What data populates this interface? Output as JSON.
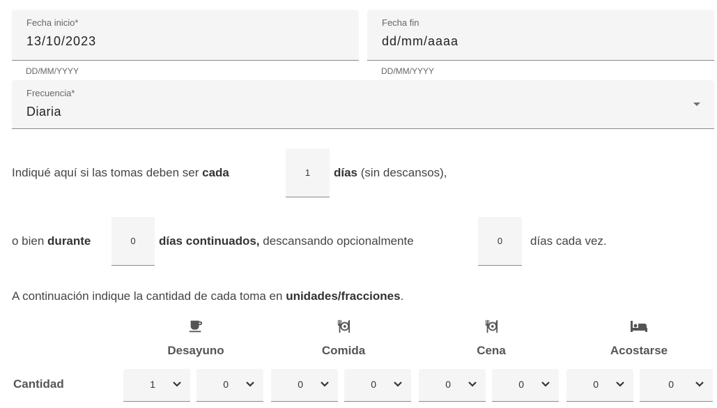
{
  "dates": {
    "start": {
      "label": "Fecha inicio*",
      "value": "13/10/2023",
      "hint": "DD/MM/YYYY"
    },
    "end": {
      "label": "Fecha fin",
      "value": "dd/mm/aaaa",
      "hint": "DD/MM/YYYY"
    }
  },
  "frequency": {
    "label": "Frecuencia*",
    "value": "Diaria"
  },
  "every": {
    "text1": "Indiqué aquí si las tomas deben ser ",
    "bold1": "cada",
    "value": "1",
    "bold2": "días",
    "text2": " (sin descansos),"
  },
  "cycle": {
    "text1": "o bien ",
    "bold1": "durante",
    "value1": "0",
    "bold2": "días continuados,",
    "text2": " descansando opcionalmente",
    "value2": "0",
    "text3": "días cada vez."
  },
  "intro": {
    "text1": "A continuación indique la cantidad de cada toma en ",
    "bold": "unidades/fracciones",
    "text2": "."
  },
  "meals": [
    {
      "label": "Desayuno",
      "icon": "coffee-icon"
    },
    {
      "label": "Comida",
      "icon": "restaurant-icon"
    },
    {
      "label": "Cena",
      "icon": "restaurant-icon"
    },
    {
      "label": "Acostarse",
      "icon": "bed-icon"
    }
  ],
  "quantity": {
    "label": "Cantidad",
    "values": [
      "1",
      "0",
      "0",
      "0",
      "0",
      "0",
      "0",
      "0"
    ]
  }
}
